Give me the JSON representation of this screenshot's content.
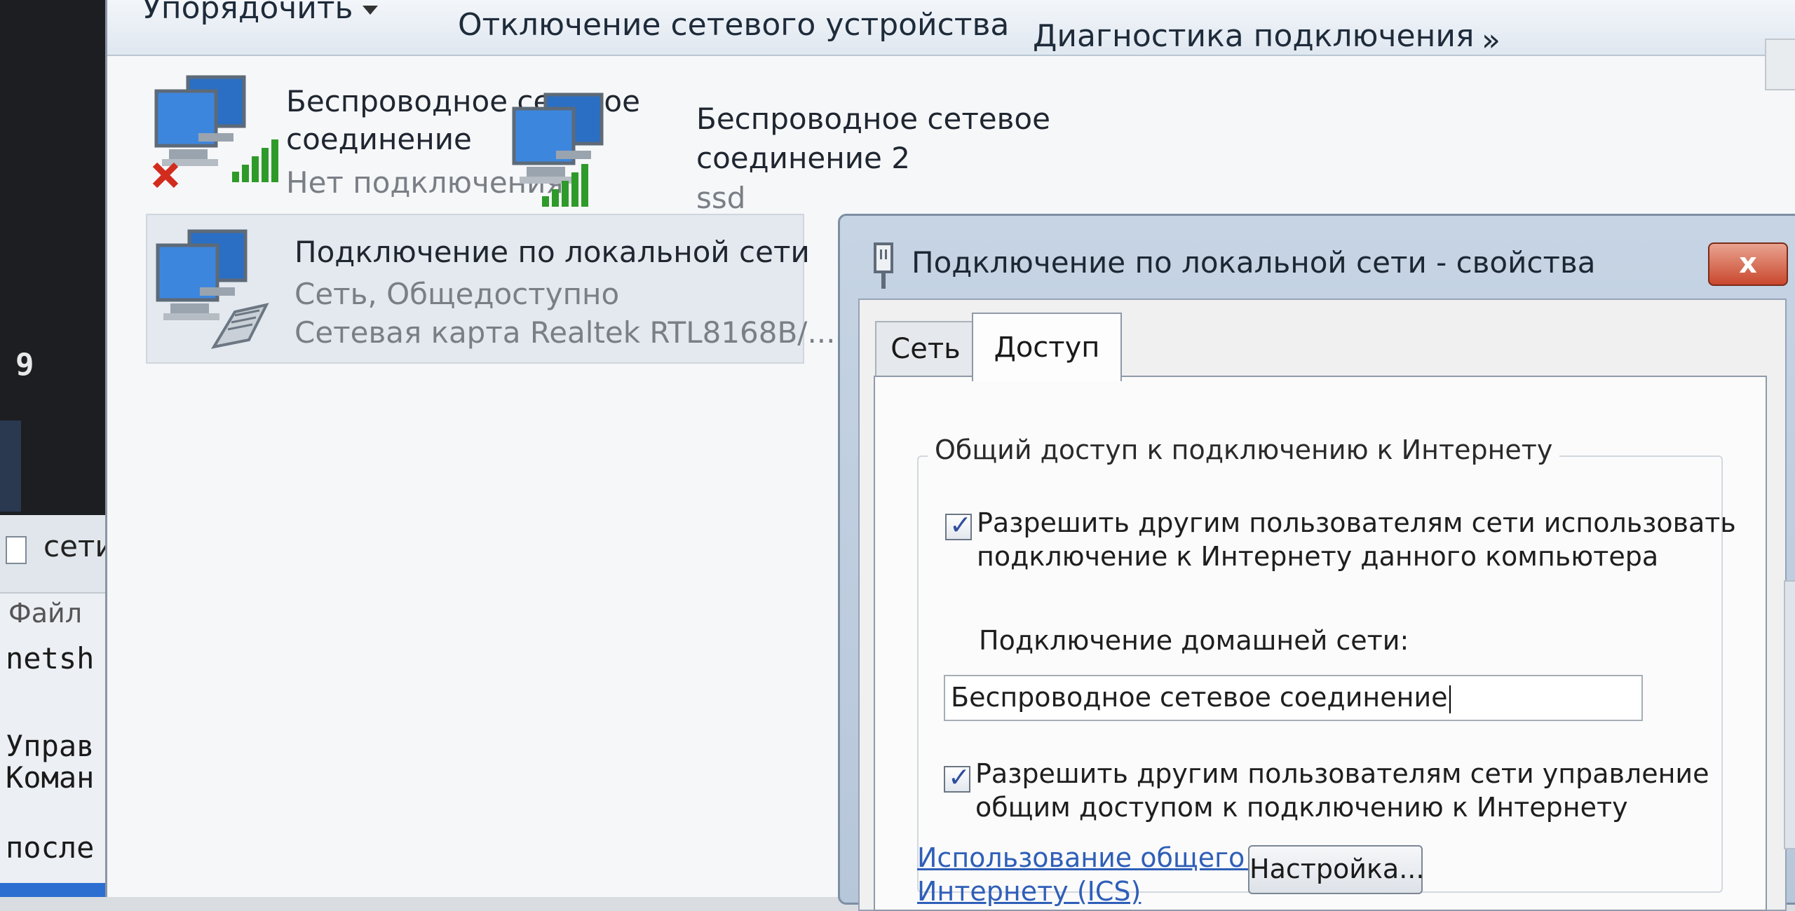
{
  "console": {
    "digit": "9",
    "notepad_title": "сети",
    "notepad_menu": "Файл",
    "lines": [
      "netsh",
      "Управ",
      "Коман",
      "после"
    ]
  },
  "toolbar": {
    "organize": "Упорядочить",
    "disable_device": "Отключение сетевого устройства",
    "diagnose": "Диагностика подключения",
    "more": "»"
  },
  "connections": [
    {
      "name_line1": "Беспроводное сетевое",
      "name_line2": "соединение",
      "status": "Нет подключения"
    },
    {
      "name_line1": "Беспроводное сетевое",
      "name_line2": "соединение 2",
      "status": "ssd"
    },
    {
      "name": "Подключение по локальной сети",
      "status": "Сеть, Общедоступно",
      "adapter": "Сетевая карта Realtek RTL8168B/..."
    }
  ],
  "dialog": {
    "title": "Подключение по локальной сети - свойства",
    "close": "x",
    "tabs": [
      "Сеть",
      "Доступ"
    ],
    "active_tab": "Доступ",
    "group_title": "Общий доступ к подключению к Интернету",
    "allow_share_line1": "Разрешить другим пользователям сети использовать",
    "allow_share_line2": "подключение к Интернету данного компьютера",
    "allow_share_checked": true,
    "home_network_label": "Подключение домашней сети:",
    "home_network_value": "Беспроводное сетевое соединение",
    "allow_control_line1": "Разрешить другим пользователям сети управление",
    "allow_control_line2": "общим доступом к подключению к Интернету",
    "allow_control_checked": true,
    "ics_link_line1": "Использование общего доступа к",
    "ics_link_line2": "Интернету (ICS)",
    "settings_button": "Настройка..."
  },
  "colors": {
    "link": "#2f5fb8",
    "close_button": "#c9482e",
    "signal_green": "#2e9a2a",
    "error_red": "#d22c1f"
  }
}
